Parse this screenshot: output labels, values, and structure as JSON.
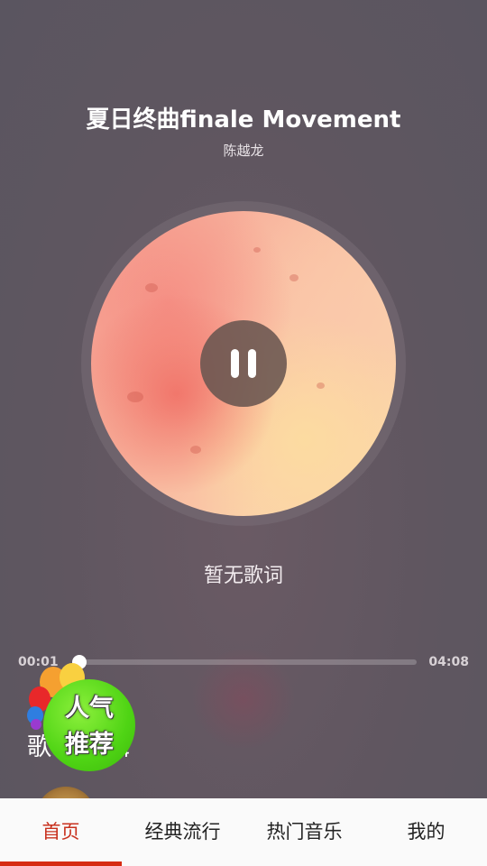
{
  "player": {
    "song_title": "夏日终曲finale Movement",
    "artist": "陈越龙",
    "lyrics_placeholder": "暂无歌词",
    "current_time": "00:01",
    "total_time": "04:08",
    "progress_fraction": 0.004,
    "state": "playing",
    "pause_icon": "pause-icon"
  },
  "section": {
    "title": "歌手专辑",
    "badge_line1": "人气",
    "badge_line2": "推荐"
  },
  "bottom_nav": {
    "items": [
      {
        "label": "首页",
        "active": true
      },
      {
        "label": "经典流行",
        "active": false
      },
      {
        "label": "热门音乐",
        "active": false
      },
      {
        "label": "我的",
        "active": false
      }
    ],
    "active_color": "#c8311e"
  }
}
